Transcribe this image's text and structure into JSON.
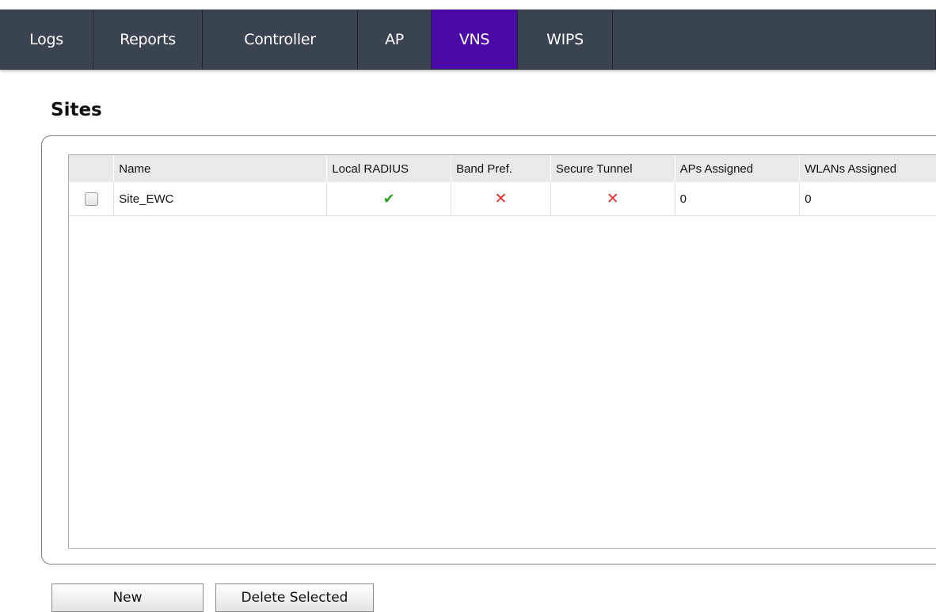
{
  "nav": {
    "tabs": [
      {
        "label": "Logs",
        "active": false
      },
      {
        "label": "Reports",
        "active": false
      },
      {
        "label": "Controller",
        "active": false
      },
      {
        "label": "AP",
        "active": false
      },
      {
        "label": "VNS",
        "active": true
      },
      {
        "label": "WIPS",
        "active": false
      }
    ],
    "active_color": "#4b0aa5",
    "bar_color": "#3a4350"
  },
  "page": {
    "title": "Sites"
  },
  "table": {
    "columns": [
      "",
      "Name",
      "Local RADIUS",
      "Band Pref.",
      "Secure Tunnel",
      "APs Assigned",
      "WLANs Assigned"
    ],
    "rows": [
      {
        "selected": false,
        "name": "Site_EWC",
        "local_radius": "check-icon",
        "band_pref": "cross-icon",
        "secure_tunnel": "cross-icon",
        "aps_assigned": "0",
        "wlans_assigned": "0"
      }
    ],
    "icon_colors": {
      "check": "#2ea12e",
      "cross": "#e33030"
    },
    "icon_glyphs": {
      "check": "✔",
      "cross": "✕"
    }
  },
  "buttons": {
    "new_label": "New",
    "delete_label": "Delete Selected"
  }
}
